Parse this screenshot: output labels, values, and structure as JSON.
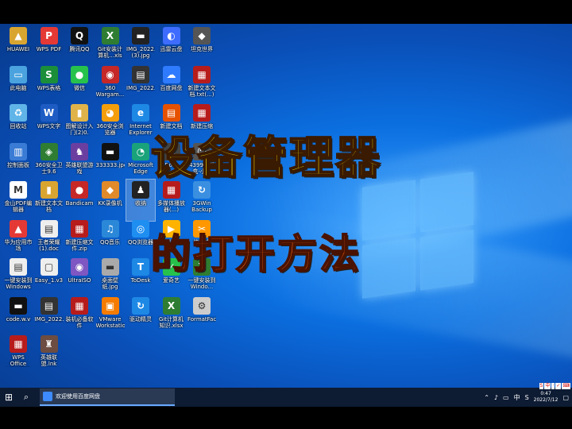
{
  "headline": {
    "line1": "设备管理器",
    "line2": "的打开方法"
  },
  "icons": [
    {
      "label": "HUAWEI",
      "color": "#d9a531",
      "glyph": "▲",
      "icon": "folder-icon"
    },
    {
      "label": "WPS PDF",
      "color": "#e53935",
      "glyph": "P",
      "icon": "pdf-icon"
    },
    {
      "label": "腾讯QQ",
      "color": "#111111",
      "glyph": "Q",
      "icon": "qq-icon"
    },
    {
      "label": "Git安装计算机...xls",
      "color": "#2e7d32",
      "glyph": "X",
      "icon": "excel-icon"
    },
    {
      "label": "IMG_2022...\n(3).jpg",
      "color": "#222222",
      "glyph": "▬",
      "icon": "image-icon"
    },
    {
      "label": "迅雷云盘",
      "color": "#3d6cff",
      "glyph": "◐",
      "icon": "cloud-icon"
    },
    {
      "label": "坦克世界",
      "color": "#555555",
      "glyph": "◆",
      "icon": "tank-icon"
    },
    {
      "label": "此电脑",
      "color": "#4aa3df",
      "glyph": "▭",
      "icon": "computer-icon"
    },
    {
      "label": "WPS表格",
      "color": "#1b8e3a",
      "glyph": "S",
      "icon": "sheet-icon"
    },
    {
      "label": "微信",
      "color": "#27c24c",
      "glyph": "●",
      "icon": "wechat-icon"
    },
    {
      "label": "360 Wargam...",
      "color": "#c62828",
      "glyph": "◉",
      "icon": "game-icon"
    },
    {
      "label": "IMG_2022...",
      "color": "#333333",
      "glyph": "▤",
      "icon": "image-icon"
    },
    {
      "label": "百度网盘",
      "color": "#2f7bff",
      "glyph": "☁",
      "icon": "baidu-icon"
    },
    {
      "label": "新建文本文档.txt(...)",
      "color": "#b71c1c",
      "glyph": "▦",
      "icon": "winrar-icon"
    },
    {
      "label": "回收站",
      "color": "#5fb4e8",
      "glyph": "♻",
      "icon": "recycle-icon"
    },
    {
      "label": "WPS文字",
      "color": "#1e5cc4",
      "glyph": "W",
      "icon": "word-icon"
    },
    {
      "label": "图解设计入门(2)0.(0...",
      "color": "#e0b34a",
      "glyph": "▮",
      "icon": "folder-icon"
    },
    {
      "label": "360安全浏览器",
      "color": "#f59e0b",
      "glyph": "◕",
      "icon": "browser-icon"
    },
    {
      "label": "Internet Explorer",
      "color": "#1e88e5",
      "glyph": "e",
      "icon": "ie-icon"
    },
    {
      "label": "新建文档",
      "color": "#e65100",
      "glyph": "▤",
      "icon": "doc-icon"
    },
    {
      "label": "新建压缩",
      "color": "#b71c1c",
      "glyph": "▦",
      "icon": "winrar-icon"
    },
    {
      "label": "控制面板",
      "color": "#3a7bd5",
      "glyph": "▥",
      "icon": "control-panel-icon"
    },
    {
      "label": "360安全卫士9.6",
      "color": "#2e7d32",
      "glyph": "◈",
      "icon": "shield-icon"
    },
    {
      "label": "英雄联盟游戏",
      "color": "#6b3fa0",
      "glyph": "♞",
      "icon": "lol-icon"
    },
    {
      "label": "333333.jpg",
      "color": "#111111",
      "glyph": "▬",
      "icon": "image-icon"
    },
    {
      "label": "Microsoft Edge",
      "color": "#1aa37a",
      "glyph": "◔",
      "icon": "edge-icon"
    },
    {
      "label": "Bo...",
      "color": "#444444",
      "glyph": "▢",
      "icon": "file-icon"
    },
    {
      "label": "4399游戏盒-小...",
      "color": "#555555",
      "glyph": "☺",
      "icon": "game-box-icon"
    },
    {
      "label": "金山PDF编辑器",
      "color": "#ffffff",
      "glyph": "M",
      "icon": "pdf-editor-icon"
    },
    {
      "label": "新建文本文档",
      "color": "#d9a531",
      "glyph": "▮",
      "icon": "folder-icon"
    },
    {
      "label": "Bandicam",
      "color": "#c62828",
      "glyph": "●",
      "icon": "bandicam-icon"
    },
    {
      "label": "KK录像机",
      "color": "#e08a2a",
      "glyph": "◆",
      "icon": "recorder-icon"
    },
    {
      "label": "收纳",
      "color": "#222222",
      "glyph": "♟",
      "icon": "file-icon"
    },
    {
      "label": "多媒体播放器(...)",
      "color": "#b71c1c",
      "glyph": "▦",
      "icon": "winrar-icon"
    },
    {
      "label": "3GWin Backup",
      "color": "#3a8fe0",
      "glyph": "↻",
      "icon": "backup-icon"
    },
    {
      "label": "华为应用市场",
      "color": "#e53935",
      "glyph": "▲",
      "icon": "appstore-icon"
    },
    {
      "label": "王者荣耀(1).doc",
      "color": "#eeeeee",
      "glyph": "▤",
      "icon": "doc-icon"
    },
    {
      "label": "新建压缩文件.zip",
      "color": "#b71c1c",
      "glyph": "▦",
      "icon": "winrar-icon"
    },
    {
      "label": "QQ音乐",
      "color": "#2b88d8",
      "glyph": "♫",
      "icon": "music-icon"
    },
    {
      "label": "QQ浏览器",
      "color": "#1f8ef1",
      "glyph": "◎",
      "icon": "qq-browser-icon"
    },
    {
      "label": "腾讯视频",
      "color": "#ffb300",
      "glyph": "▶",
      "icon": "video-icon"
    },
    {
      "label": "快剪辑",
      "color": "#ff9800",
      "glyph": "✂",
      "icon": "editor-icon"
    },
    {
      "label": "一键安装到Windows",
      "color": "#eeeeee",
      "glyph": "▤",
      "icon": "doc-icon"
    },
    {
      "label": "Easy_1.v3",
      "color": "#eeeeee",
      "glyph": "▢",
      "icon": "file-icon"
    },
    {
      "label": "UltraISO",
      "color": "#7e57c2",
      "glyph": "◉",
      "icon": "disc-icon"
    },
    {
      "label": "桌面壁纸.jpg",
      "color": "#aaaaaa",
      "glyph": "▬",
      "icon": "image-icon"
    },
    {
      "label": "ToDesk",
      "color": "#1e88e5",
      "glyph": "T",
      "icon": "todesk-icon"
    },
    {
      "label": "爱奇艺",
      "color": "#27c24c",
      "glyph": "✓",
      "icon": "iqiyi-icon"
    },
    {
      "label": "一键安装到Windo...",
      "color": "#2e7d32",
      "glyph": "X",
      "icon": "excel-icon"
    },
    {
      "label": "code.w.v",
      "color": "#111111",
      "glyph": "▬",
      "icon": "image-icon"
    },
    {
      "label": "IMG_2022...",
      "color": "#333333",
      "glyph": "▤",
      "icon": "image-icon"
    },
    {
      "label": "装机必备软件",
      "color": "#b71c1c",
      "glyph": "▦",
      "icon": "winrar-icon"
    },
    {
      "label": "VMware Workstation",
      "color": "#f57c00",
      "glyph": "▣",
      "icon": "vmware-icon"
    },
    {
      "label": "驱动精灵",
      "color": "#1e88e5",
      "glyph": "↻",
      "icon": "driver-icon"
    },
    {
      "label": "Git计算机知识.xlsx",
      "color": "#2e7d32",
      "glyph": "X",
      "icon": "excel-icon"
    },
    {
      "label": "FormatFactory",
      "color": "#cccccc",
      "glyph": "⚙",
      "icon": "factory-icon"
    },
    {
      "label": "WPS Office 2019专业版",
      "color": "#b71c1c",
      "glyph": "▦",
      "icon": "wps-icon"
    },
    {
      "label": "英雄联盟.lnk",
      "color": "#6d4c41",
      "glyph": "♜",
      "icon": "lol-icon"
    }
  ],
  "taskbar": {
    "active_task": "欢迎使用百度网盘",
    "clock_time": "0:47",
    "clock_date": "2022/7/12",
    "ime": "中"
  },
  "ime_bar": [
    "S",
    "中",
    "·",
    "✓",
    "⌨"
  ]
}
